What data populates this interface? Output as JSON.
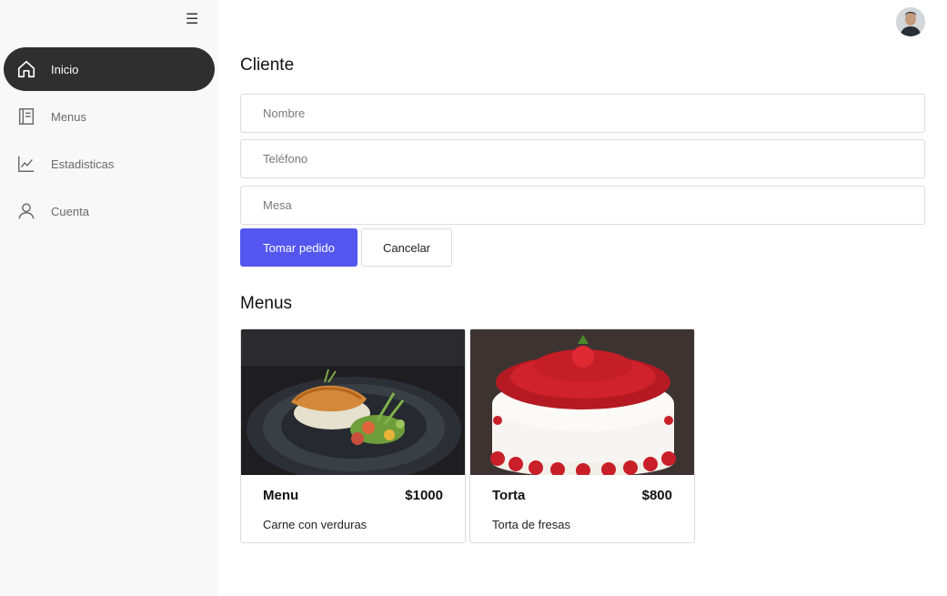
{
  "sidebar": {
    "menu_toggle_icon": "hamburger-icon",
    "items": [
      {
        "label": "Inicio",
        "icon": "home-icon",
        "active": true
      },
      {
        "label": "Menus",
        "icon": "notebook-icon",
        "active": false
      },
      {
        "label": "Estadisticas",
        "icon": "chart-line-icon",
        "active": false
      },
      {
        "label": "Cuenta",
        "icon": "user-icon",
        "active": false
      }
    ]
  },
  "header": {
    "avatar_icon": "avatar"
  },
  "cliente": {
    "title": "Cliente",
    "nombre_placeholder": "Nombre",
    "telefono_placeholder": "Teléfono",
    "mesa_placeholder": "Mesa",
    "submit_label": "Tomar pedido",
    "cancel_label": "Cancelar"
  },
  "menus": {
    "title": "Menus",
    "cards": [
      {
        "name": "Menu",
        "price": "$1000",
        "description": "Carne con verduras"
      },
      {
        "name": "Torta",
        "price": "$800",
        "description": "Torta de fresas"
      }
    ]
  },
  "colors": {
    "primary": "#5457ef",
    "sidebar_active": "#2f2f2f",
    "sidebar_bg": "#f8f8f8"
  }
}
